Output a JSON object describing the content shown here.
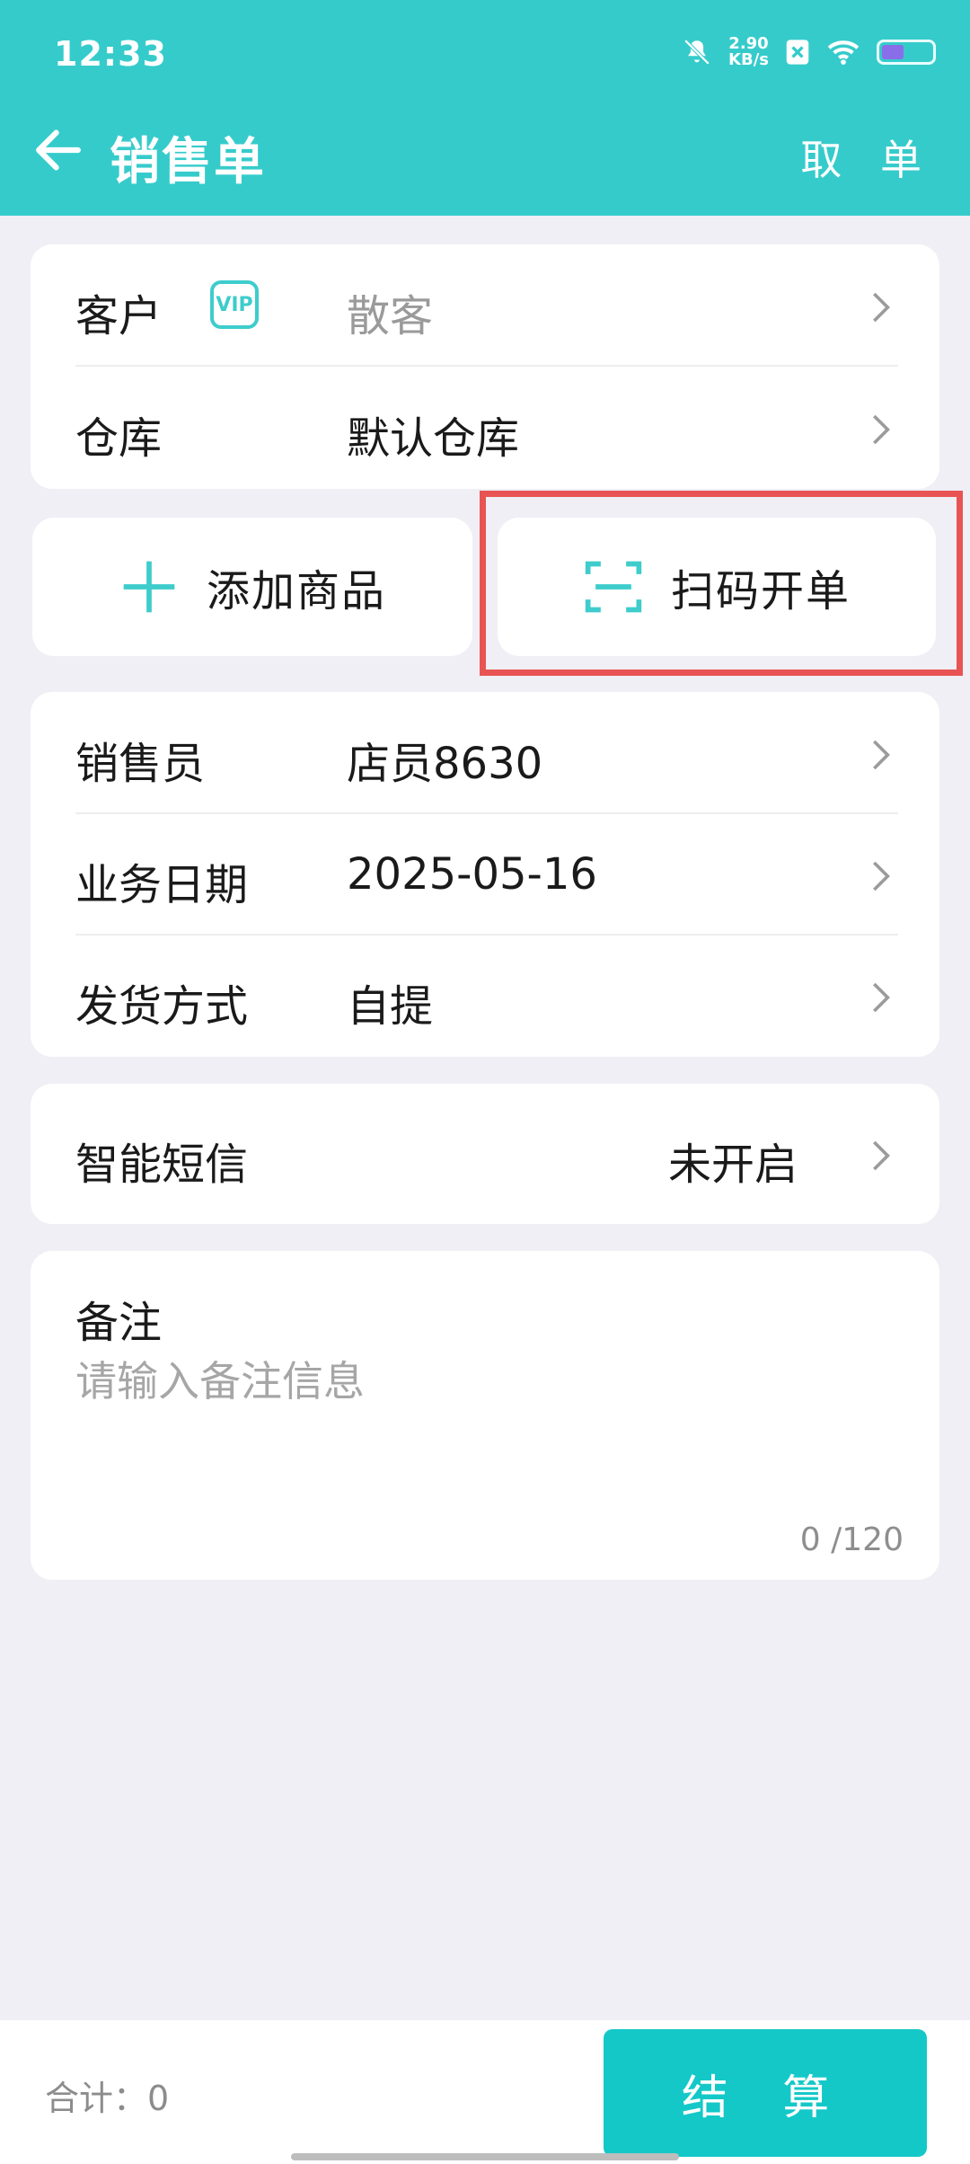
{
  "status_bar": {
    "time": "12:33",
    "net_speed_value": "2.90",
    "net_speed_unit": "KB/s"
  },
  "header": {
    "title": "销售单",
    "cancel_label": "取 单"
  },
  "customer_card": {
    "customer_label": "客户",
    "vip_badge": "VIP",
    "customer_value": "散客",
    "warehouse_label": "仓库",
    "warehouse_value": "默认仓库"
  },
  "actions": {
    "add_product": "添加商品",
    "scan_order": "扫码开单"
  },
  "info_card": {
    "salesperson_label": "销售员",
    "salesperson_value": "店员8630",
    "date_label": "业务日期",
    "date_value": "2025-05-16",
    "shipping_label": "发货方式",
    "shipping_value": "自提"
  },
  "sms_card": {
    "label": "智能短信",
    "value": "未开启"
  },
  "remark": {
    "label": "备注",
    "placeholder": "请输入备注信息",
    "counter": "0 /120"
  },
  "bottom_bar": {
    "total": "合计：0",
    "checkout_label": "结 算"
  },
  "colors": {
    "header": "#36cbcb",
    "accent": "#14c8c8",
    "highlight": "#e85453"
  }
}
